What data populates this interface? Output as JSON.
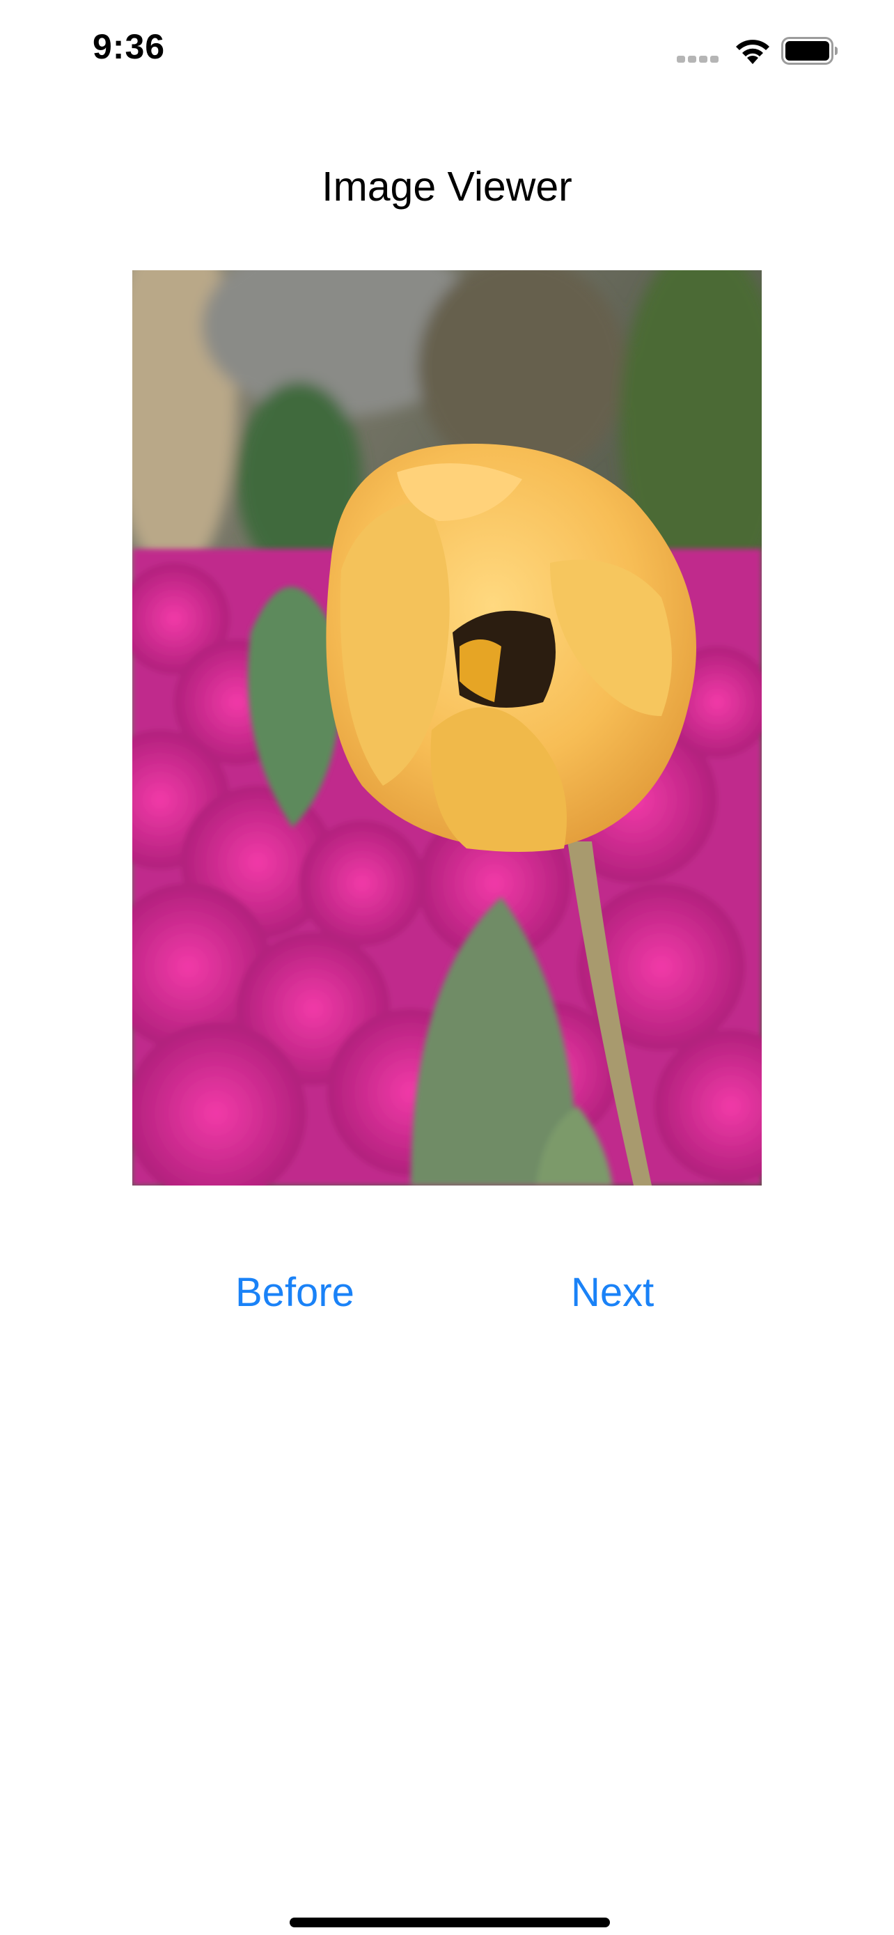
{
  "status_bar": {
    "time": "9:36",
    "icons": [
      "cellular-signal-icon",
      "wifi-icon",
      "battery-icon"
    ]
  },
  "header": {
    "title": "Image Viewer"
  },
  "main": {
    "image_subject": "yellow tulip bud in front of pink flowers"
  },
  "controls": {
    "before_label": "Before",
    "next_label": "Next"
  },
  "colors": {
    "accent": "#1a82f7",
    "background": "#ffffff",
    "text": "#000000"
  }
}
